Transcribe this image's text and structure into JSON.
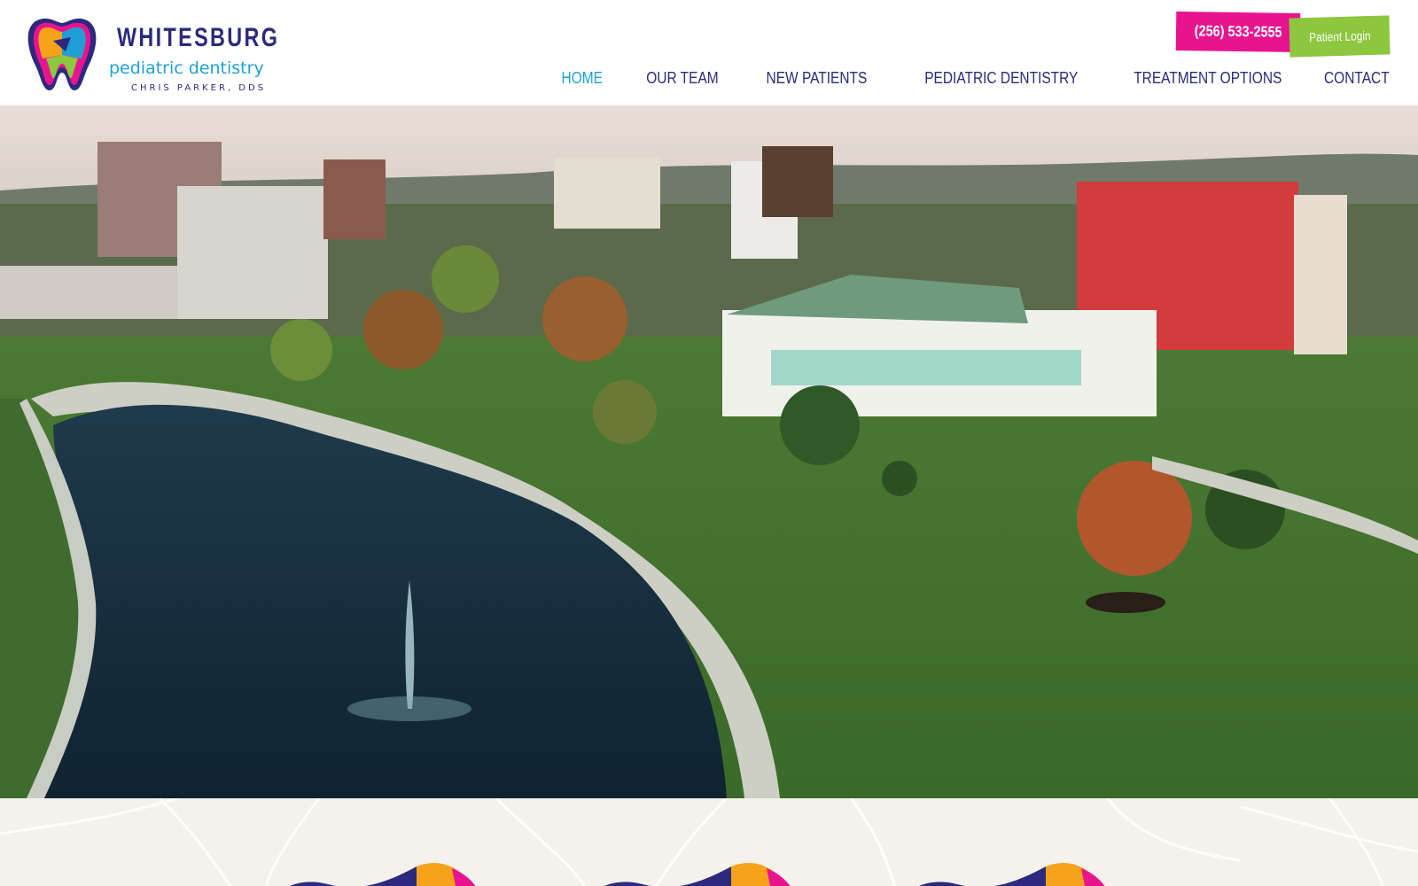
{
  "brand": {
    "title": "WHITESBURG",
    "subtitle": "pediatric dentistry",
    "doctor": "CHRIS PARKER, DDS"
  },
  "header": {
    "phone_label": "(256) 533-2555",
    "login_label": "Patient Login",
    "colors": {
      "primary": "#2b2a7e",
      "accent": "#1ea0d6",
      "phone_bg": "#e8148e",
      "login_bg": "#8dc63f"
    }
  },
  "nav": {
    "items": [
      {
        "label": "HOME",
        "active": true
      },
      {
        "label": "OUR TEAM",
        "active": false
      },
      {
        "label": "NEW PATIENTS",
        "active": false
      },
      {
        "label": "PEDIATRIC DENTISTRY",
        "active": false
      },
      {
        "label": "TREATMENT OPTIONS",
        "active": false
      },
      {
        "label": "CONTACT",
        "active": false
      }
    ]
  },
  "hero": {
    "image": "aerial-city-park-icon"
  }
}
